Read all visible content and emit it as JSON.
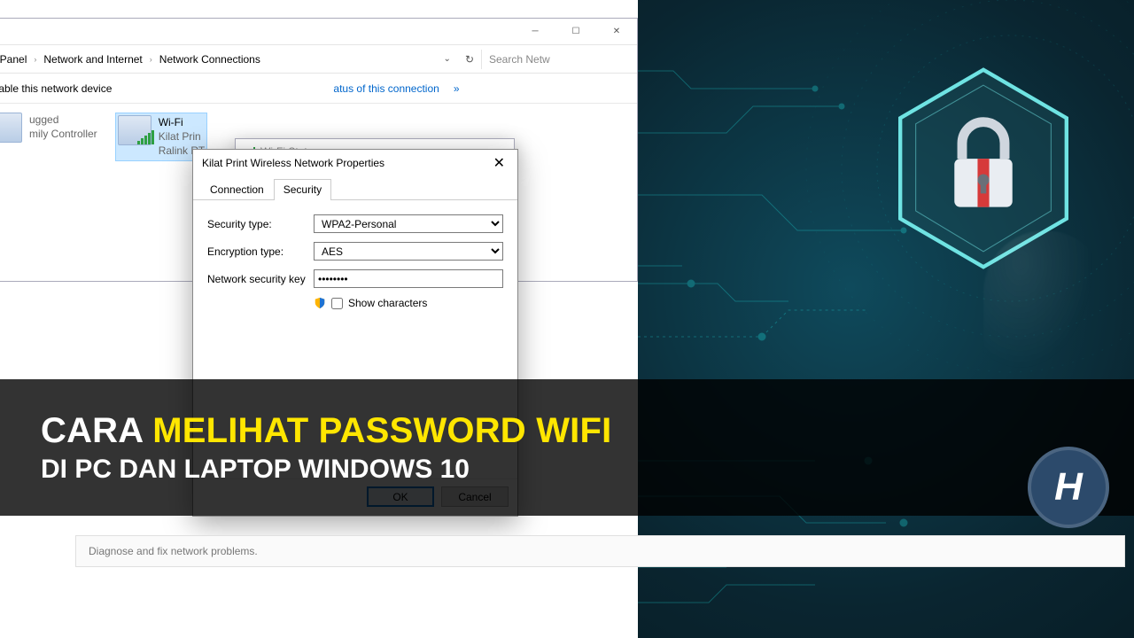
{
  "explorer": {
    "breadcrumbs": [
      "rol Panel",
      "Network and Internet",
      "Network Connections"
    ],
    "search_placeholder": "Search Netw",
    "cmdbar": {
      "disable": "Disable this network device",
      "rest_text": "atus of this connection",
      "more": "»"
    },
    "adapters": [
      {
        "line1": "",
        "line2": "ugged",
        "line3": "mily Controller"
      },
      {
        "line1": "Wi-Fi",
        "line2": "Kilat Prin",
        "line3": "Ralink RT"
      }
    ]
  },
  "status_dialog": {
    "title": "Wi-Fi Status"
  },
  "props_dialog": {
    "title": "Kilat Print Wireless Network Properties",
    "tabs": {
      "connection": "Connection",
      "security": "Security"
    },
    "labels": {
      "sec_type": "Security type:",
      "enc_type": "Encryption type:",
      "key": "Network security key",
      "show": "Show characters"
    },
    "values": {
      "sec_type": "WPA2-Personal",
      "enc_type": "AES",
      "key": "••••••••"
    },
    "buttons": {
      "ok": "OK",
      "cancel": "Cancel"
    }
  },
  "bottom_panel": "Diagnose and fix network problems.",
  "overlay": {
    "line1a": "CARA ",
    "line1b": "MELIHAT PASSWORD WIFI",
    "line2": "DI PC DAN LAPTOP WINDOWS 10"
  },
  "logo_letter": "H"
}
